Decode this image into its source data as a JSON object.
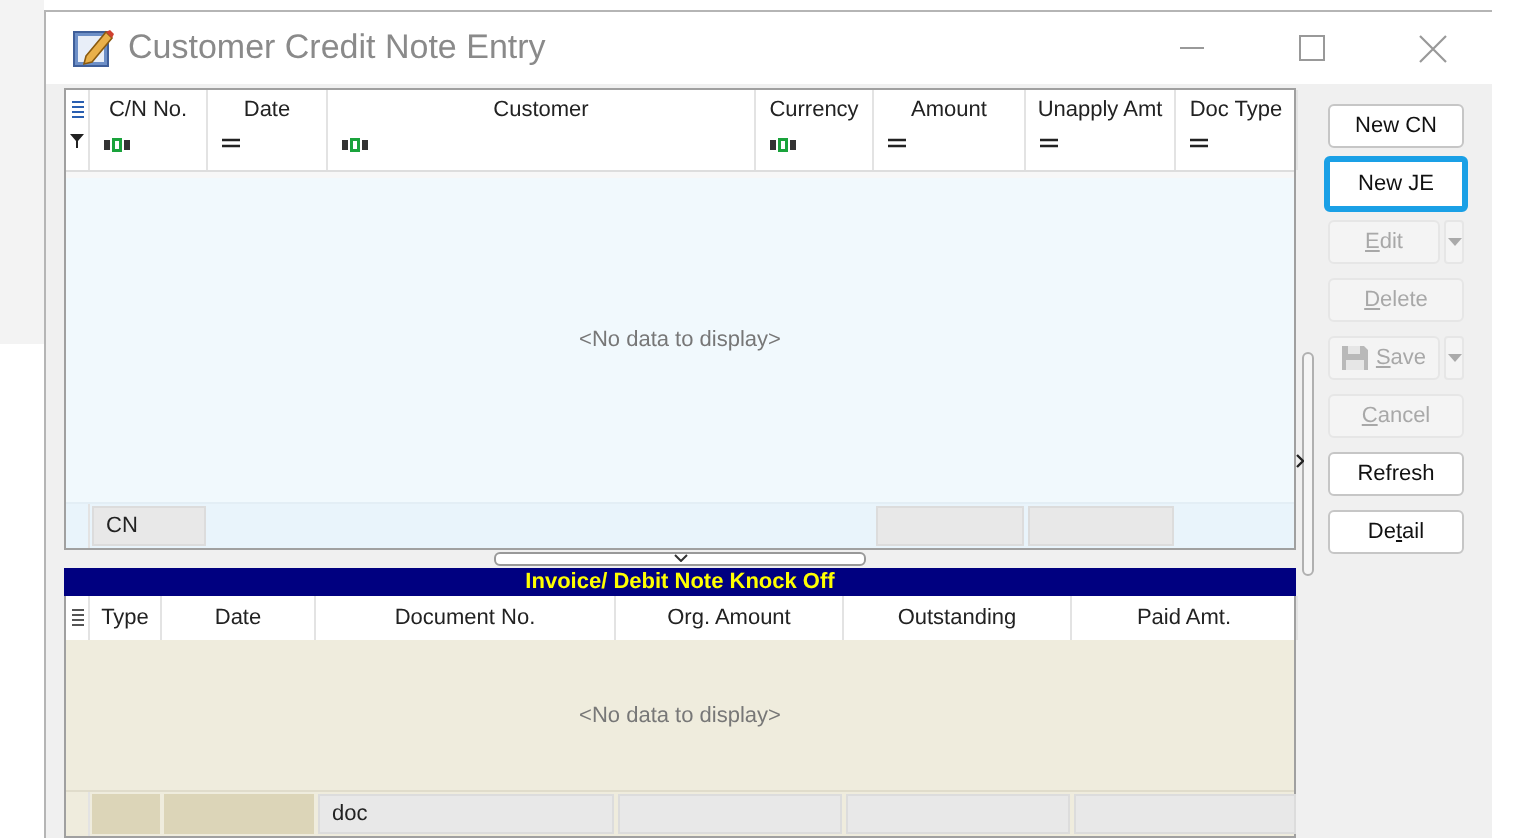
{
  "window": {
    "title": "Customer Credit Note Entry"
  },
  "credit_notes": {
    "columns": [
      {
        "label": "C/N No.",
        "kind": "textfilter"
      },
      {
        "label": "Date",
        "kind": "equalsfilter"
      },
      {
        "label": "Customer",
        "kind": "textfilter"
      },
      {
        "label": "Currency",
        "kind": "textfilter"
      },
      {
        "label": "Amount",
        "kind": "equalsfilter"
      },
      {
        "label": "Unapply Amt",
        "kind": "equalsfilter"
      },
      {
        "label": "Doc Type",
        "kind": "equalsfilter"
      }
    ],
    "empty_text": "<No data to display>",
    "footer": [
      {
        "kind": "summary",
        "text": "CN"
      },
      {
        "kind": "blank"
      },
      {
        "kind": "blank"
      },
      {
        "kind": "blank"
      },
      {
        "kind": "summary"
      },
      {
        "kind": "summary"
      },
      {
        "kind": "blank"
      }
    ]
  },
  "knock_off": {
    "title": "Invoice/ Debit Note Knock Off",
    "columns": [
      {
        "label": "Type"
      },
      {
        "label": "Date"
      },
      {
        "label": "Document No."
      },
      {
        "label": "Org. Amount"
      },
      {
        "label": "Outstanding"
      },
      {
        "label": "Paid Amt."
      }
    ],
    "empty_text": "<No data to display>",
    "footer": [
      {
        "kind": "tan"
      },
      {
        "kind": "tan"
      },
      {
        "kind": "summary",
        "text": "doc"
      },
      {
        "kind": "summary"
      },
      {
        "kind": "summary"
      },
      {
        "kind": "summary"
      }
    ]
  },
  "buttons": [
    {
      "label_pre": "New CN",
      "disabled": false,
      "focused": false,
      "dropdown": false,
      "save_icon": false
    },
    {
      "label_pre": "New JE",
      "disabled": false,
      "focused": true,
      "dropdown": false,
      "save_icon": false
    },
    {
      "access_key": "E",
      "label_post": "dit",
      "disabled": true,
      "focused": false,
      "dropdown": true,
      "save_icon": false
    },
    {
      "access_key": "D",
      "label_post": "elete",
      "disabled": true,
      "focused": false,
      "dropdown": false,
      "save_icon": false
    },
    {
      "access_key": "S",
      "label_post": "ave",
      "disabled": true,
      "focused": false,
      "dropdown": true,
      "save_icon": true
    },
    {
      "access_key": "C",
      "label_post": "ancel",
      "disabled": true,
      "focused": false,
      "dropdown": false,
      "save_icon": false
    },
    {
      "label_pre": "Refresh",
      "disabled": false,
      "focused": false,
      "dropdown": false,
      "save_icon": false
    },
    {
      "label_pre": "De",
      "access_key": "t",
      "label_post": "ail",
      "disabled": false,
      "focused": false,
      "dropdown": false,
      "save_icon": false
    }
  ]
}
